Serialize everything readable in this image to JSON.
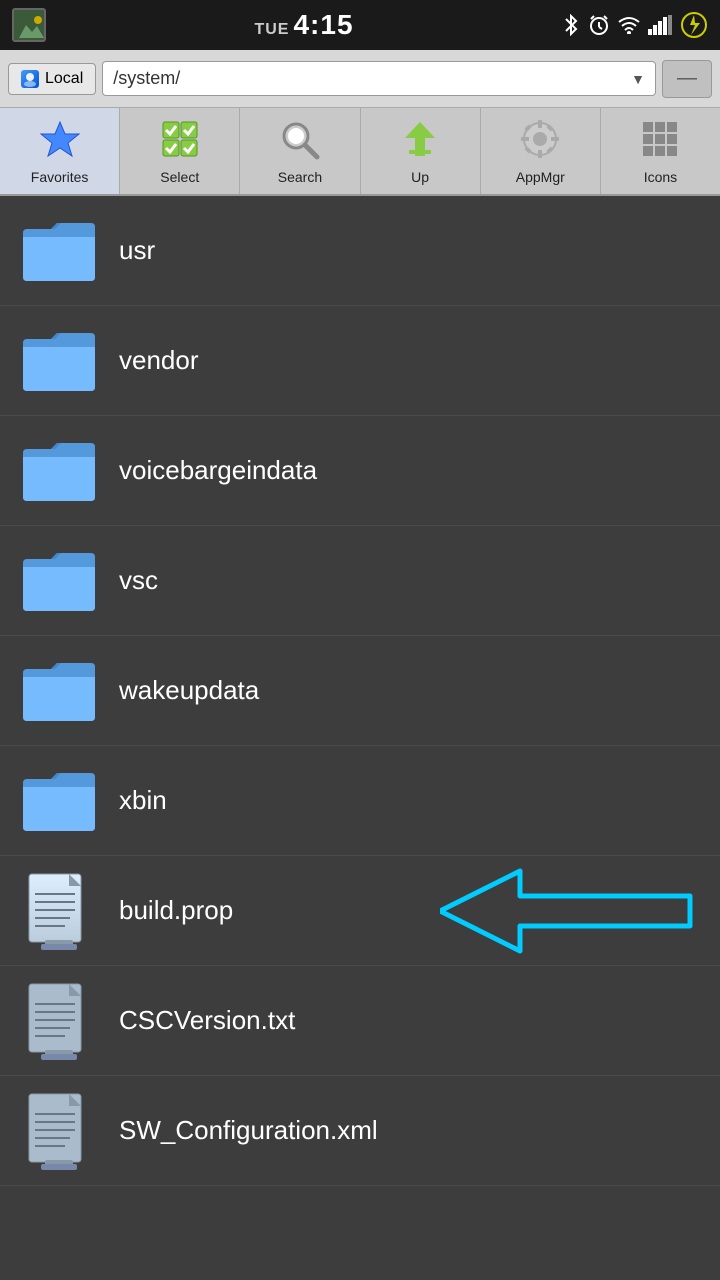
{
  "statusBar": {
    "day": "TUE",
    "time": "4:15",
    "icons": {
      "bluetooth": "✦",
      "alarm": "⏰",
      "wifi": "WiFi",
      "signal": "|||",
      "battery": "⚡"
    }
  },
  "addressBar": {
    "localLabel": "Local",
    "path": "/system/",
    "dashLabel": "—"
  },
  "toolbar": {
    "items": [
      {
        "id": "favorites",
        "label": "Favorites"
      },
      {
        "id": "select",
        "label": "Select"
      },
      {
        "id": "search",
        "label": "Search"
      },
      {
        "id": "up",
        "label": "Up"
      },
      {
        "id": "appmgr",
        "label": "AppMgr"
      },
      {
        "id": "icons",
        "label": "Icons"
      }
    ]
  },
  "fileList": {
    "items": [
      {
        "id": "usr",
        "name": "usr",
        "type": "folder"
      },
      {
        "id": "vendor",
        "name": "vendor",
        "type": "folder"
      },
      {
        "id": "voicebargeindata",
        "name": "voicebargeindata",
        "type": "folder"
      },
      {
        "id": "vsc",
        "name": "vsc",
        "type": "folder"
      },
      {
        "id": "wakeupdata",
        "name": "wakeupdata",
        "type": "folder"
      },
      {
        "id": "xbin",
        "name": "xbin",
        "type": "folder"
      },
      {
        "id": "build.prop",
        "name": "build.prop",
        "type": "file",
        "highlighted": true
      },
      {
        "id": "CSCVersion.txt",
        "name": "CSCVersion.txt",
        "type": "file"
      },
      {
        "id": "SW_Configuration.xml",
        "name": "SW_Configuration.xml",
        "type": "file"
      }
    ]
  },
  "colors": {
    "background": "#3d3d3d",
    "statusBar": "#1a1a1a",
    "toolbar": "#c8c8c8",
    "arrowColor": "#00ccff",
    "fileText": "#ffffff",
    "folderBlue": "#5599ee"
  }
}
